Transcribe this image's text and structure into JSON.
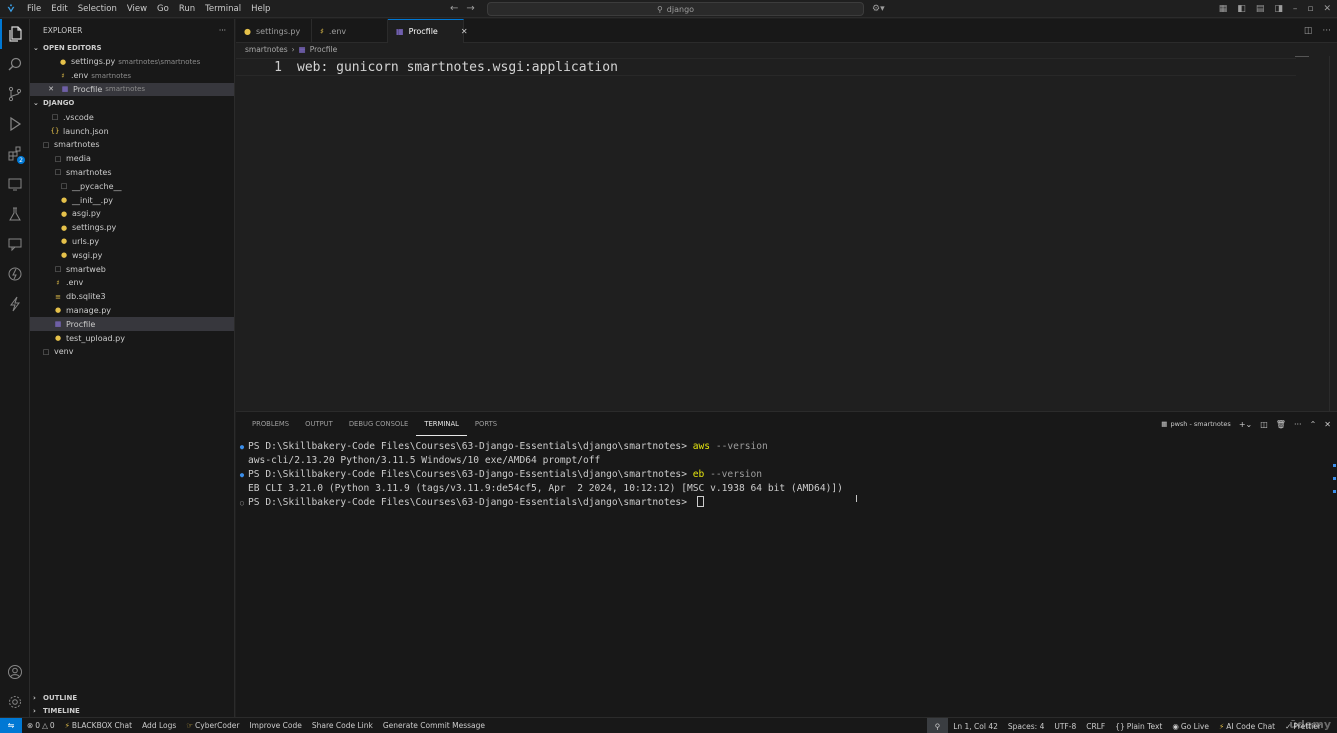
{
  "titlebar": {
    "menu": [
      "File",
      "Edit",
      "Selection",
      "View",
      "Go",
      "Run",
      "Terminal",
      "Help"
    ],
    "search_text": "django"
  },
  "activity": {
    "extensions_badge": "2"
  },
  "explorer": {
    "title": "EXPLORER",
    "open_editors_label": "OPEN EDITORS",
    "open_editors": [
      {
        "name": "settings.py",
        "desc": "smartnotes\\smartnotes",
        "icon": "python-icon"
      },
      {
        "name": ".env",
        "desc": "smartnotes",
        "icon": "env-icon"
      },
      {
        "name": "Procfile",
        "desc": "smartnotes",
        "icon": "procfile-icon"
      }
    ],
    "workspace_label": "DJANGO",
    "tree": [
      {
        "name": ".vscode",
        "icon": "folder-icon"
      },
      {
        "name": "launch.json",
        "icon": "json-icon"
      },
      {
        "name": "smartnotes",
        "icon": "folder-icon"
      },
      {
        "name": "media",
        "icon": "folder-icon"
      },
      {
        "name": "smartnotes",
        "icon": "folder-icon"
      },
      {
        "name": "__pycache__",
        "icon": "folder-icon"
      },
      {
        "name": "__init__.py",
        "icon": "python-icon"
      },
      {
        "name": "asgi.py",
        "icon": "python-icon"
      },
      {
        "name": "settings.py",
        "icon": "python-icon"
      },
      {
        "name": "urls.py",
        "icon": "python-icon"
      },
      {
        "name": "wsgi.py",
        "icon": "python-icon"
      },
      {
        "name": "smartweb",
        "icon": "folder-icon"
      },
      {
        "name": ".env",
        "icon": "env-icon"
      },
      {
        "name": "db.sqlite3",
        "icon": "database-icon"
      },
      {
        "name": "manage.py",
        "icon": "python-icon"
      },
      {
        "name": "Procfile",
        "icon": "procfile-icon"
      },
      {
        "name": "test_upload.py",
        "icon": "python-icon"
      },
      {
        "name": "venv",
        "icon": "folder-icon"
      }
    ],
    "outline_label": "OUTLINE",
    "timeline_label": "TIMELINE"
  },
  "tabs": [
    {
      "label": "settings.py",
      "icon": "python-icon"
    },
    {
      "label": ".env",
      "icon": "env-icon"
    },
    {
      "label": "Procfile",
      "icon": "procfile-icon"
    }
  ],
  "breadcrumb": {
    "folder": "smartnotes",
    "file": "Procfile"
  },
  "editor": {
    "line_number": "1",
    "code": "web: gunicorn smartnotes.wsgi:application"
  },
  "panel": {
    "tabs": [
      "PROBLEMS",
      "OUTPUT",
      "DEBUG CONSOLE",
      "TERMINAL",
      "PORTS"
    ],
    "terminal_name": "pwsh - smartnotes",
    "lines": [
      {
        "prompt": "PS D:\\Skillbakery-Code Files\\Courses\\63-Django-Essentials\\django\\smartnotes> ",
        "cmd": "aws",
        "arg": " --version"
      },
      {
        "text": "aws-cli/2.13.20 Python/3.11.5 Windows/10 exe/AMD64 prompt/off"
      },
      {
        "prompt": "PS D:\\Skillbakery-Code Files\\Courses\\63-Django-Essentials\\django\\smartnotes> ",
        "cmd": "eb",
        "arg": " --version"
      },
      {
        "text": "EB CLI 3.21.0 (Python 3.11.9 (tags/v3.11.9:de54cf5, Apr  2 2024, 10:12:12) [MSC v.1938 64 bit (AMD64)])"
      },
      {
        "prompt": "PS D:\\Skillbakery-Code Files\\Courses\\63-Django-Essentials\\django\\smartnotes> "
      }
    ]
  },
  "statusbar": {
    "errors": "0",
    "warnings": "0",
    "left_items": [
      "BLACKBOX Chat",
      "Add Logs",
      "CyberCoder",
      "Improve Code",
      "Share Code Link",
      "Generate Commit Message"
    ],
    "position": "Ln 1, Col 42",
    "spaces": "Spaces: 4",
    "encoding": "UTF-8",
    "eol": "CRLF",
    "language": "Plain Text",
    "golive": "Go Live",
    "aichat": "AI Code Chat",
    "prettier": "Prettier"
  },
  "watermark": "ūdemy",
  "colors": {
    "accent": "#0078d4",
    "background": "#1f1f1f",
    "sidebar": "#181818"
  }
}
